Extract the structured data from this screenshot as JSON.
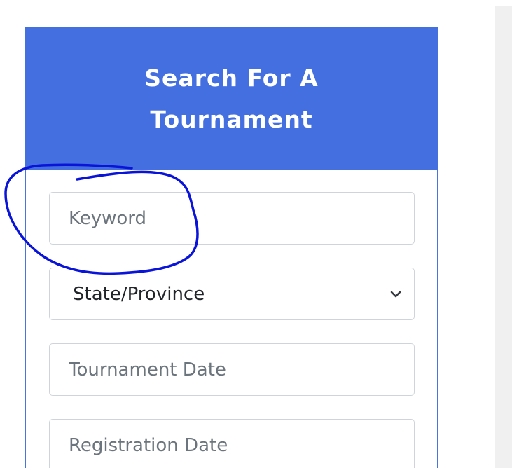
{
  "search_card": {
    "title_line1": "Search For A",
    "title_line2": "Tournament",
    "header_color": "#446fe0"
  },
  "fields": {
    "keyword_placeholder": "Keyword",
    "state_selected": "State/Province",
    "tournament_date_placeholder": "Tournament Date",
    "registration_date_placeholder": "Registration Date"
  },
  "annotation": {
    "color": "#0a14d8",
    "shape": "hand-drawn circle around keyword field"
  },
  "icons": {
    "select_arrow": "chevron-down-icon"
  }
}
